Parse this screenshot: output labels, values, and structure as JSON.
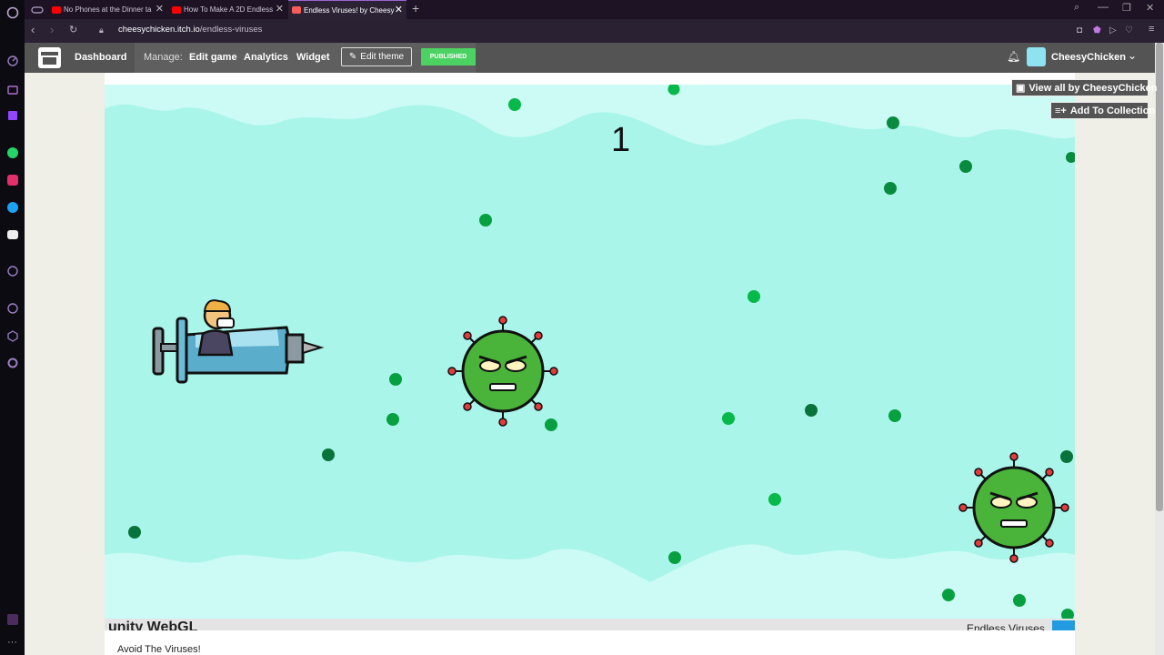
{
  "browser": {
    "tabs": [
      {
        "title": "No Phones at the Dinner ta",
        "favicon": "youtube-icon",
        "active": false
      },
      {
        "title": "How To Make A 2D Endless",
        "favicon": "youtube-icon",
        "active": false
      },
      {
        "title": "Endless Viruses! by Cheesy",
        "favicon": "itch-icon",
        "active": true
      }
    ],
    "url_domain": "cheesychicken.itch.io",
    "url_path": "/endless-viruses"
  },
  "itch_bar": {
    "dashboard": "Dashboard",
    "manage_label": "Manage:",
    "edit_game": "Edit game",
    "analytics": "Analytics",
    "widget": "Widget",
    "edit_theme": "Edit theme",
    "published": "PUBLISHED",
    "username": "CheesyChicken"
  },
  "side_buttons": {
    "view_all": "View all by CheesyChicken",
    "add_collection": "Add To Collection"
  },
  "game": {
    "score": "1",
    "engine_label": "unity WebGL",
    "game_title_footer": "Endless Viruses"
  },
  "description": "Avoid The Viruses!",
  "colors": {
    "game_bg": "#aaf5e9",
    "published_green": "#4cd262",
    "itch_bar": "#545454",
    "opera_accent": "#9b62d7"
  }
}
